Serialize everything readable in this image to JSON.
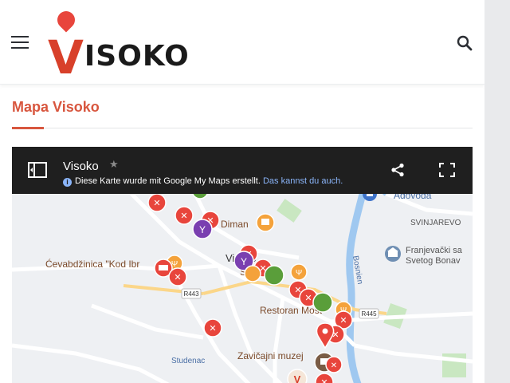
{
  "header": {
    "logo_text": "ISOKO",
    "logo_v": "V"
  },
  "page": {
    "title": "Mapa Visoko"
  },
  "map": {
    "title": "Visoko",
    "subtitle_text": "Diese Karte wurde mit Google My Maps erstellt.",
    "subtitle_link": "Das kannst du auch.",
    "labels": {
      "adovoda": "Adovoda",
      "svinjarevo": "SVINJAREVO",
      "diman": "Diman",
      "cevabdzinica": "Ćevabdžinica \"Kod Ibr",
      "visoko": "Visoko",
      "semi": "Semi",
      "restoran": "Restoran Most",
      "franjevacki_1": "Franjevački sa",
      "franjevacki_2": "Svetog Bonav",
      "bosnien": "Bosnien",
      "studenac": "Studenac",
      "zavicajni": "Zavičajni muzej",
      "r443": "R443",
      "r445": "R445"
    }
  },
  "colors": {
    "accent": "#d8563e",
    "restaurant_pin": "#e8453c",
    "orange_pin": "#f4a23b",
    "bar_pin": "#7a3fb0",
    "green_pin": "#5a9e3a",
    "cafe_pin": "#7a5c45",
    "map_bg": "#eef0f3",
    "river": "#9fc8f0",
    "map_header": "#1f1f1f"
  },
  "icons": {
    "menu": "hamburger-icon",
    "search": "search-icon",
    "panel": "side-panel-icon",
    "share": "share-icon",
    "fullscreen": "fullscreen-icon",
    "star": "star-icon",
    "info": "info-icon"
  }
}
